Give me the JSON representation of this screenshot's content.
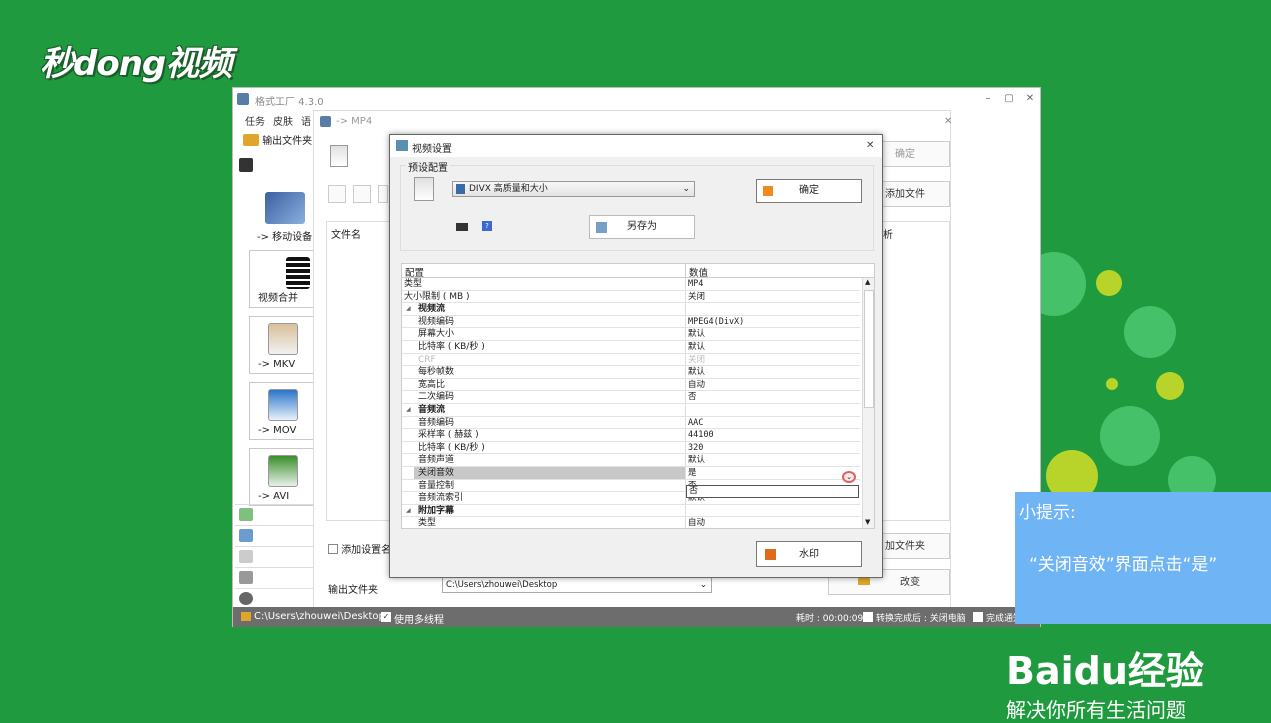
{
  "brand": {
    "logo_text": "秒dong视频"
  },
  "main_window": {
    "title": "格式工厂 4.3.0",
    "menu": [
      "任务",
      "皮肤",
      "语"
    ],
    "toolbar": {
      "output_folder_label": "输出文件夹"
    },
    "sidebar_tiles": [
      "-> 移动设备",
      "视频合并",
      "-> MKV",
      "-> MOV",
      "-> AVI"
    ],
    "status": {
      "path": "C:\\Users\\zhouwei\\Desktop",
      "multithread_label": "使用多线程",
      "elapsed": "耗时 : 00:00:09",
      "after_complete": "转换完成后 : 关闭电脑",
      "complete_notify": "完成通知"
    }
  },
  "sub_window": {
    "title": "-> MP4",
    "confirm_label": "确定",
    "add_file_label": "添加文件",
    "file_name_header": "文件名",
    "analysis_header": "析",
    "add_setting_label": "添加设置名",
    "add_folder_label": "加文件夹",
    "output_folder_label": "输出文件夹",
    "output_folder_value": "C:\\Users\\zhouwei\\Desktop",
    "change_label": "改变"
  },
  "dialog": {
    "title": "视频设置",
    "preset_group_label": "预设配置",
    "preset_value": "DIVX 高质量和大小",
    "ok_label": "确定",
    "save_as_label": "另存为",
    "watermark_label": "水印",
    "grid": {
      "header_key": "配置",
      "header_value": "数值",
      "rows": [
        {
          "k": "类型",
          "v": "MP4",
          "kind": "top"
        },
        {
          "k": "大小限制 ( MB )",
          "v": "关闭",
          "kind": "top"
        },
        {
          "k": "视频流",
          "v": "",
          "kind": "sec"
        },
        {
          "k": "视频编码",
          "v": "MPEG4(DivX)",
          "kind": "sub"
        },
        {
          "k": "屏幕大小",
          "v": "默认",
          "kind": "sub"
        },
        {
          "k": "比特率 ( KB/秒 )",
          "v": "默认",
          "kind": "sub"
        },
        {
          "k": "CRF",
          "v": "关闭",
          "kind": "disabled"
        },
        {
          "k": "每秒帧数",
          "v": "默认",
          "kind": "sub"
        },
        {
          "k": "宽高比",
          "v": "自动",
          "kind": "sub"
        },
        {
          "k": "二次编码",
          "v": "否",
          "kind": "sub"
        },
        {
          "k": "音频流",
          "v": "",
          "kind": "sec"
        },
        {
          "k": "音频编码",
          "v": "AAC",
          "kind": "sub"
        },
        {
          "k": "采样率 ( 赫兹 )",
          "v": "44100",
          "kind": "sub"
        },
        {
          "k": "比特率 ( KB/秒 )",
          "v": "320",
          "kind": "sub"
        },
        {
          "k": "音频声道",
          "v": "默认",
          "kind": "sub"
        },
        {
          "k": "关闭音效",
          "v": "是",
          "kind": "selected"
        },
        {
          "k": "音量控制",
          "v": "否",
          "kind": "sub"
        },
        {
          "k": "音频流索引",
          "v": "默认",
          "kind": "sub"
        },
        {
          "k": "附加字幕",
          "v": "",
          "kind": "sec"
        },
        {
          "k": "类型",
          "v": "自动",
          "kind": "sub"
        }
      ],
      "dropdown_option": "否"
    }
  },
  "tip": {
    "title": "小提示:",
    "body": "“关闭音效”界面点击“是”"
  },
  "baidu": {
    "logo": "Baidu经验",
    "slogan": "解决你所有生活问题"
  }
}
